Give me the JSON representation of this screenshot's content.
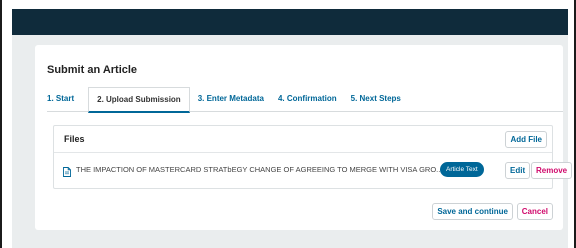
{
  "page": {
    "title": "Submit an Article"
  },
  "tabs": [
    {
      "label": "1. Start"
    },
    {
      "label": "2. Upload Submission"
    },
    {
      "label": "3. Enter Metadata"
    },
    {
      "label": "4. Confirmation"
    },
    {
      "label": "5. Next Steps"
    }
  ],
  "files": {
    "title": "Files",
    "add_label": "Add File",
    "items": [
      {
        "name": "THE IMPACTION OF MASTERCARD STRATbEGY CHANGE OF AGREEING TO MERGE WITH VISA GRO...",
        "type": "Article Text",
        "edit_label": "Edit",
        "remove_label": "Remove",
        "icon": "document-icon"
      }
    ]
  },
  "actions": {
    "save_label": "Save and continue",
    "cancel_label": "Cancel"
  },
  "colors": {
    "topbar": "#0f2b3b",
    "accent": "#006798",
    "danger": "#d00a6c",
    "background": "#eaedee"
  }
}
